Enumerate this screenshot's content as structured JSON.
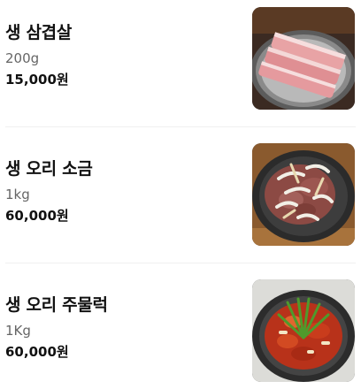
{
  "menu": {
    "items": [
      {
        "name": "생 삼겹살",
        "size": "200g",
        "price": "15,000원",
        "photo_icon": "pork-belly-photo"
      },
      {
        "name": "생 오리 소금",
        "size": "1kg",
        "price": "60,000원",
        "photo_icon": "salted-duck-photo"
      },
      {
        "name": "생 오리 주물럭",
        "size": "1Kg",
        "price": "60,000원",
        "photo_icon": "spicy-duck-photo"
      }
    ]
  }
}
